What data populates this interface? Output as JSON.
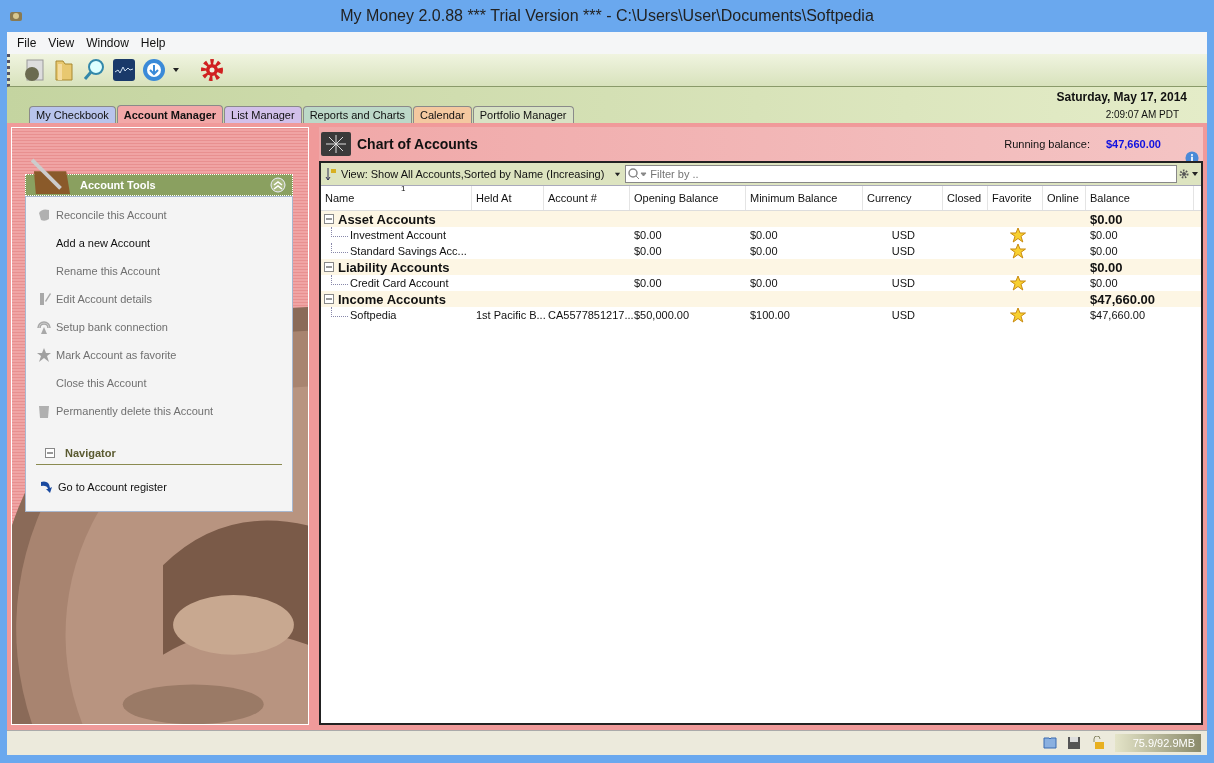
{
  "window": {
    "title": "My Money 2.0.88 *** Trial Version *** - C:\\Users\\User\\Documents\\Softpedia"
  },
  "menu": [
    "File",
    "View",
    "Window",
    "Help"
  ],
  "tabs": [
    {
      "label": "My Checkbook",
      "selected": false,
      "color": "#b8c4ec"
    },
    {
      "label": "Account Manager",
      "selected": true,
      "color": "#f2a8a8"
    },
    {
      "label": "List Manager",
      "selected": false,
      "color": "#d2c0ea"
    },
    {
      "label": "Reports and Charts",
      "selected": false,
      "color": "#bcd8c8"
    },
    {
      "label": "Calendar",
      "selected": false,
      "color": "#f4c8a0"
    },
    {
      "label": "Portfolio Manager",
      "selected": false,
      "color": "#d8e2c4"
    }
  ],
  "date": "Saturday, May 17, 2014",
  "time": "2:09:07 AM PDT",
  "tools": {
    "title": "Account Tools",
    "items": [
      {
        "label": "Reconcile this Account",
        "disabled": true
      },
      {
        "label": "Add a new Account",
        "disabled": false
      },
      {
        "label": "Rename this Account",
        "disabled": true
      },
      {
        "label": "Edit Account details",
        "disabled": true
      },
      {
        "label": "Setup bank connection",
        "disabled": true
      },
      {
        "label": "Mark Account as favorite",
        "disabled": true
      },
      {
        "label": "Close this Account",
        "disabled": true
      },
      {
        "label": "Permanently delete this Account",
        "disabled": true
      }
    ],
    "navigator": {
      "title": "Navigator",
      "expanded": true,
      "items": [
        "Go to Account register"
      ]
    }
  },
  "chart": {
    "title": "Chart of Accounts",
    "running_label": "Running balance:",
    "running_value": "$47,660.00",
    "view": "View: Show All Accounts,Sorted by Name (Increasing)",
    "filter_placeholder": "Filter by ..",
    "sort_mark": "1",
    "columns": [
      "Name",
      "Held At",
      "Account #",
      "Opening Balance",
      "Minimum Balance",
      "Currency",
      "Closed",
      "Favorite",
      "Online",
      "Balance"
    ],
    "rows": [
      {
        "kind": "group",
        "name": "Asset Accounts",
        "expanded": true,
        "balance": "$0.00"
      },
      {
        "kind": "account",
        "name": "Investment Account",
        "held_at": "",
        "number": "",
        "opening": "$0.00",
        "minimum": "$0.00",
        "currency": "USD",
        "favorite": true,
        "balance": "$0.00"
      },
      {
        "kind": "account",
        "name": "Standard Savings Acc...",
        "held_at": "",
        "number": "",
        "opening": "$0.00",
        "minimum": "$0.00",
        "currency": "USD",
        "favorite": true,
        "balance": "$0.00"
      },
      {
        "kind": "group",
        "name": "Liability Accounts",
        "expanded": true,
        "balance": "$0.00"
      },
      {
        "kind": "account",
        "name": "Credit Card Account",
        "held_at": "",
        "number": "",
        "opening": "$0.00",
        "minimum": "$0.00",
        "currency": "USD",
        "favorite": true,
        "balance": "$0.00"
      },
      {
        "kind": "group",
        "name": "Income Accounts",
        "expanded": true,
        "balance": "$47,660.00"
      },
      {
        "kind": "account",
        "name": "Softpedia",
        "held_at": "1st Pacific B...",
        "number": "CA5577851217...",
        "opening": "$50,000.00",
        "minimum": "$100.00",
        "currency": "USD",
        "favorite": true,
        "balance": "$47,660.00"
      }
    ]
  },
  "status": {
    "memory": "75.9/92.9MB"
  }
}
